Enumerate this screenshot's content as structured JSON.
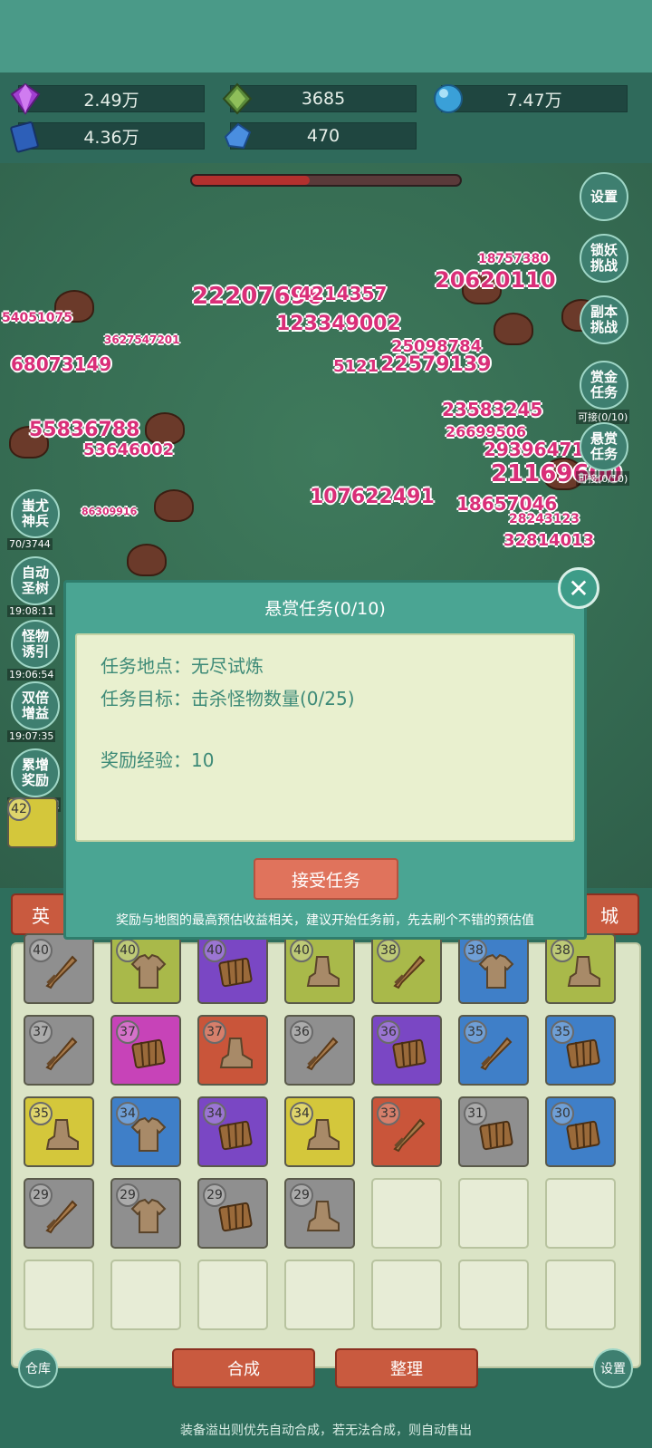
{
  "resources": [
    {
      "icon": "purple-gem-icon",
      "value": "2.49万"
    },
    {
      "icon": "green-crystal-icon",
      "value": "3685"
    },
    {
      "icon": "blue-orb-icon",
      "value": "7.47万"
    },
    {
      "icon": "blue-book-icon",
      "value": "4.36万"
    },
    {
      "icon": "blue-crystal-icon",
      "value": "470"
    }
  ],
  "battle": {
    "damage_numbers": [
      "22207696",
      "4214357",
      "20620110",
      "18757380",
      "54051075",
      "123349002",
      "3627547201",
      "25098784",
      "68073149",
      "5121",
      "22579139",
      "23583245",
      "55836788",
      "26699506",
      "29396471",
      "53646002",
      "21169600",
      "107622491",
      "18657046",
      "86309916",
      "28243123",
      "32814013"
    ],
    "hp_fraction": 0.44
  },
  "side_buttons_right": [
    {
      "label": "设置",
      "sub": ""
    },
    {
      "label": "锁妖\n挑战",
      "sub": ""
    },
    {
      "label": "副本\n挑战",
      "sub": ""
    },
    {
      "label": "赏金\n任务",
      "sub": "可接(0/10)"
    },
    {
      "label": "悬赏\n任务",
      "sub": "可接(0/10)"
    }
  ],
  "side_buttons_left": [
    {
      "label": "蚩尤\n神兵",
      "sub": "70/3744"
    },
    {
      "label": "自动\n圣树",
      "sub": "19:08:11"
    },
    {
      "label": "怪物\n诱引",
      "sub": "19:06:54"
    },
    {
      "label": "双倍\n增益",
      "sub": "19:07:35"
    },
    {
      "label": "累增\n奖励",
      "sub": "明天再来吧"
    }
  ],
  "tabs": {
    "left": "英",
    "right": "城"
  },
  "dialog": {
    "title": "悬赏任务(0/10)",
    "location_label": "任务地点：",
    "location_value": "无尽试炼",
    "target_label": "任务目标：",
    "target_value": "击杀怪物数量(0/25)",
    "reward_label": "奖励经验：",
    "reward_value": "10",
    "accept_label": "接受任务",
    "note": "奖励与地图的最高预估收益相关，建议开始任务前，先去刷个不错的预估值"
  },
  "inventory": [
    {
      "level": "40",
      "color": "#8f8f8f",
      "type": "sword"
    },
    {
      "level": "40",
      "color": "#a9b94a",
      "type": "shirt"
    },
    {
      "level": "40",
      "color": "#7a47c4",
      "type": "armor"
    },
    {
      "level": "40",
      "color": "#a9b94a",
      "type": "boots"
    },
    {
      "level": "38",
      "color": "#a9b94a",
      "type": "sword"
    },
    {
      "level": "38",
      "color": "#3f7fc8",
      "type": "shirt"
    },
    {
      "level": "38",
      "color": "#a9b94a",
      "type": "boots"
    },
    {
      "level": "37",
      "color": "#8f8f8f",
      "type": "sword"
    },
    {
      "level": "37",
      "color": "#c743b8",
      "type": "armor"
    },
    {
      "level": "37",
      "color": "#c9553a",
      "type": "boots"
    },
    {
      "level": "36",
      "color": "#8f8f8f",
      "type": "sword"
    },
    {
      "level": "36",
      "color": "#7a47c4",
      "type": "armor"
    },
    {
      "level": "35",
      "color": "#3f7fc8",
      "type": "sword"
    },
    {
      "level": "35",
      "color": "#3f7fc8",
      "type": "armor"
    },
    {
      "level": "35",
      "color": "#d4c73b",
      "type": "boots"
    },
    {
      "level": "34",
      "color": "#3f7fc8",
      "type": "shirt"
    },
    {
      "level": "34",
      "color": "#7a47c4",
      "type": "armor"
    },
    {
      "level": "34",
      "color": "#d4c73b",
      "type": "boots"
    },
    {
      "level": "33",
      "color": "#c9553a",
      "type": "sword"
    },
    {
      "level": "31",
      "color": "#8f8f8f",
      "type": "armor"
    },
    {
      "level": "30",
      "color": "#3f7fc8",
      "type": "armor"
    },
    {
      "level": "29",
      "color": "#8f8f8f",
      "type": "sword"
    },
    {
      "level": "29",
      "color": "#8f8f8f",
      "type": "shirt"
    },
    {
      "level": "29",
      "color": "#8f8f8f",
      "type": "armor"
    },
    {
      "level": "29",
      "color": "#8f8f8f",
      "type": "boots"
    }
  ],
  "quickbar_level": "42",
  "bottom": {
    "warehouse": "仓库",
    "merge": "合成",
    "sort": "整理",
    "settings": "设置",
    "footnote": "装备溢出则优先自动合成，若无法合成，则自动售出"
  }
}
